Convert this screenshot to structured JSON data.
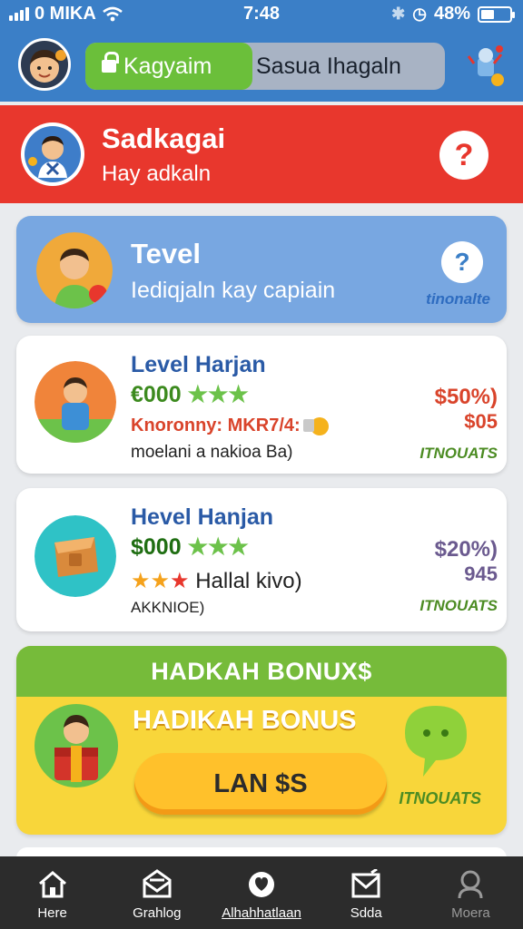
{
  "status_bar": {
    "carrier": "0 MIKA",
    "time": "7:48",
    "battery": "48%",
    "battery_level": 0.48
  },
  "header": {
    "tab_active": "Kagyaim",
    "tab_inactive": "Sasua Ihagaln"
  },
  "banner": {
    "title": "Sadkagai",
    "subtitle": "Hay adkaln",
    "help": "?"
  },
  "level_card": {
    "title": "Tevel",
    "subtitle": "Iediqjaln kay capiain",
    "help": "?",
    "tag": "tinonalte"
  },
  "offers": [
    {
      "title": "Level Harjan",
      "price": "€000",
      "stars": 3,
      "subtitle": "Knoronny: MKR7/4:",
      "note": "moelani a nakioa Ba)",
      "percent": "$50%)",
      "amount": "$05",
      "tag": "ITNOUATS"
    },
    {
      "title": "Hevel Hanjan",
      "price": "$000",
      "stars": 3,
      "subtitle": "Hallal kivo)",
      "note": "AKKNIOE)",
      "percent": "$20%)",
      "amount": "945",
      "tag": "ITNOUATS"
    }
  ],
  "bonus": {
    "header": "HADKAH BONUX$",
    "title": "HADIKAH BONUS",
    "button": "LAN $S",
    "tag": "ITNOUATS"
  },
  "nav": {
    "items": [
      {
        "label": "Here",
        "icon": "home-icon"
      },
      {
        "label": "Grahlog",
        "icon": "mail-icon"
      },
      {
        "label": "Alhahhatlaan",
        "icon": "heart-icon"
      },
      {
        "label": "Sdda",
        "icon": "envelope-icon"
      },
      {
        "label": "Moera",
        "icon": "profile-icon"
      }
    ]
  },
  "colors": {
    "header_blue": "#3b7fc7",
    "banner_red": "#e8372d",
    "card_blue": "#78a7e1",
    "bonus_green": "#76bb3a",
    "bonus_yellow": "#f8d63a",
    "nav_dark": "#2c2c2c"
  }
}
